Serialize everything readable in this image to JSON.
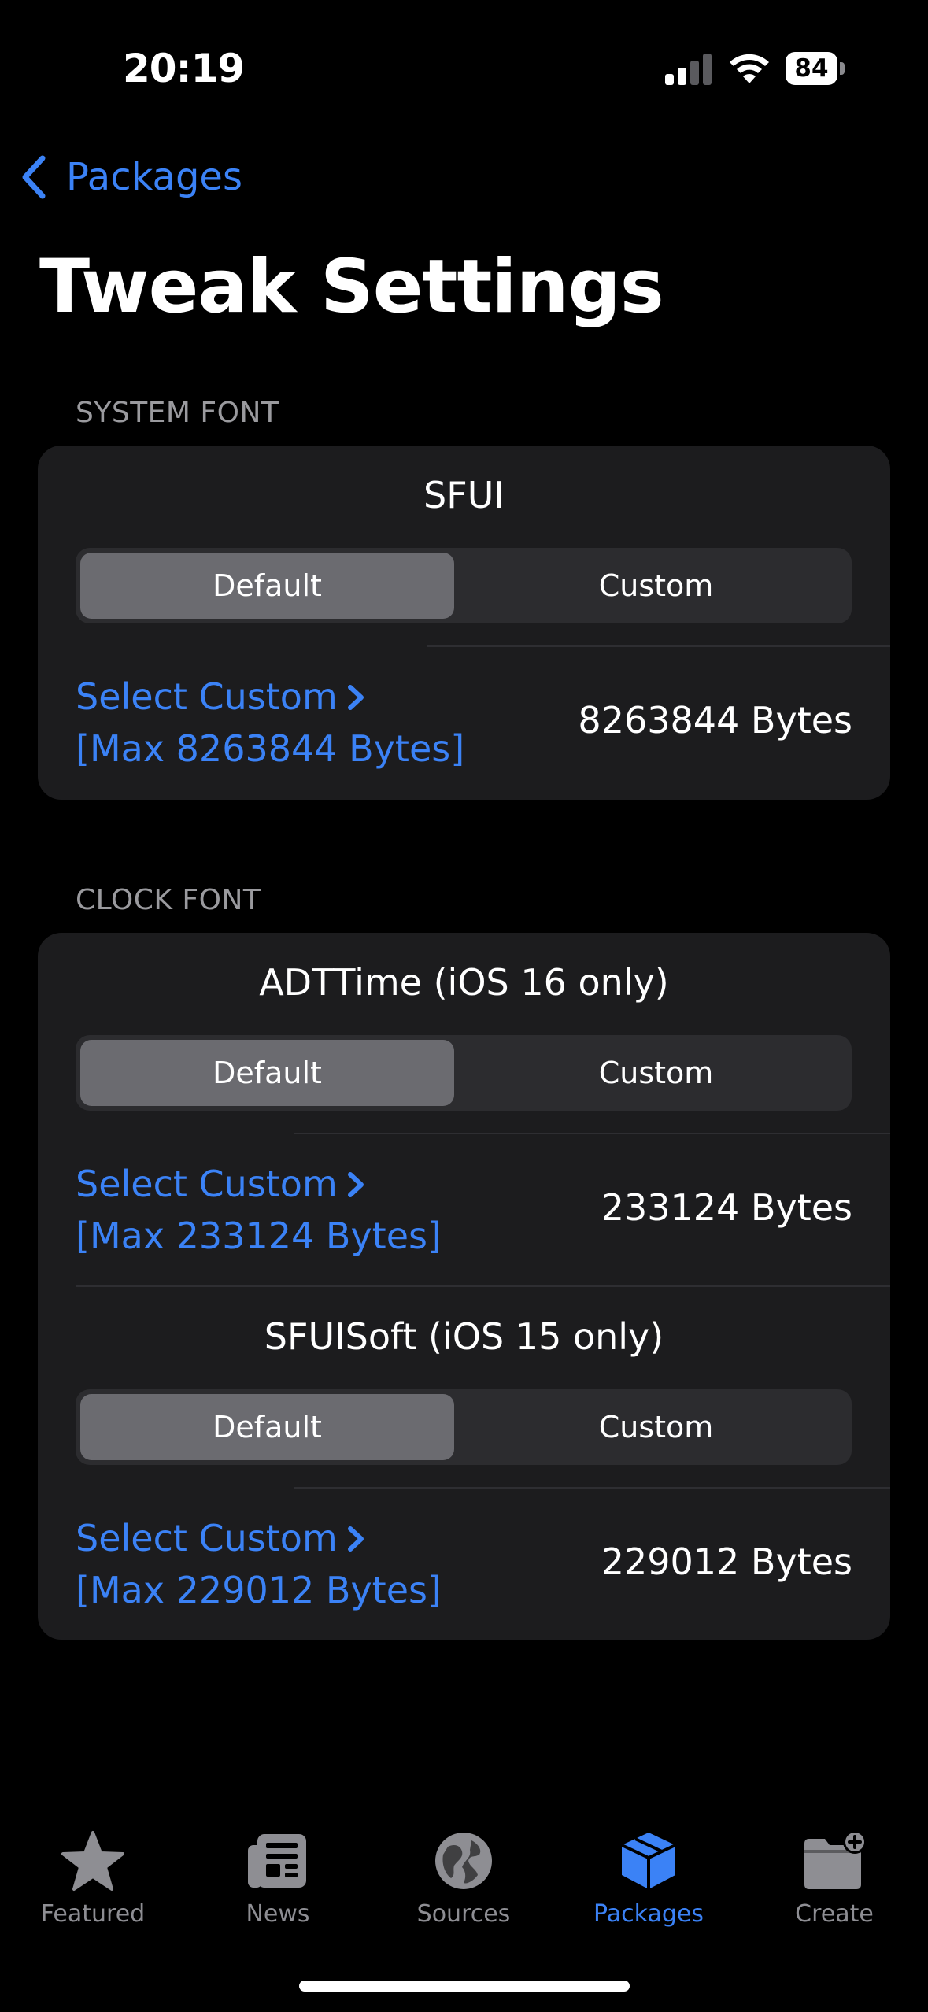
{
  "status_bar": {
    "time": "20:19",
    "battery": "84"
  },
  "nav": {
    "back_label": "Packages",
    "title": "Tweak Settings"
  },
  "sections": [
    {
      "header": "SYSTEM FONT",
      "rows": [
        {
          "title": "SFUI",
          "segments": [
            "Default",
            "Custom"
          ],
          "selected": "Default",
          "select_label": "Select Custom",
          "max_label": "[Max 8263844 Bytes]",
          "bytes": "8263844 Bytes"
        }
      ]
    },
    {
      "header": "CLOCK FONT",
      "rows": [
        {
          "title": "ADTTime (iOS 16 only)",
          "segments": [
            "Default",
            "Custom"
          ],
          "selected": "Default",
          "select_label": "Select Custom",
          "max_label": "[Max 233124 Bytes]",
          "bytes": "233124 Bytes"
        },
        {
          "title": "SFUISoft (iOS 15 only)",
          "segments": [
            "Default",
            "Custom"
          ],
          "selected": "Default",
          "select_label": "Select Custom",
          "max_label": "[Max 229012 Bytes]",
          "bytes": "229012 Bytes"
        }
      ]
    }
  ],
  "tab_bar": {
    "items": [
      {
        "label": "Featured",
        "icon": "star-icon"
      },
      {
        "label": "News",
        "icon": "newspaper-icon"
      },
      {
        "label": "Sources",
        "icon": "globe-icon"
      },
      {
        "label": "Packages",
        "icon": "package-icon",
        "active": true
      },
      {
        "label": "Create",
        "icon": "folder-plus-icon"
      }
    ]
  },
  "colors": {
    "accent": "#3b82f6",
    "background": "#000000",
    "card": "#1c1c1e",
    "secondary_text": "#9a9a9e"
  }
}
